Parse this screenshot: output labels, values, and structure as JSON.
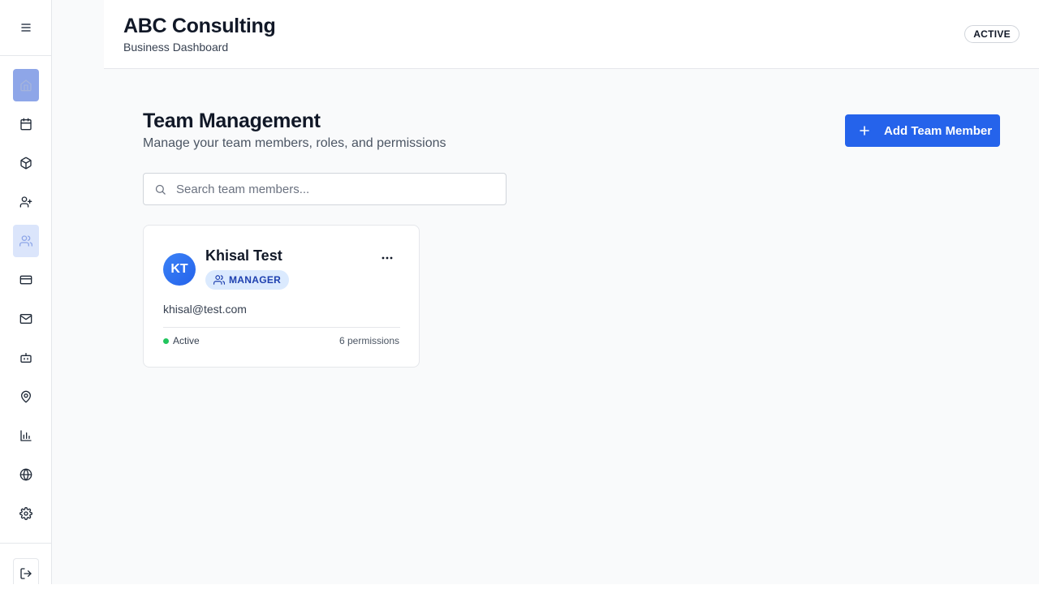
{
  "header": {
    "company_name": "ABC Consulting",
    "subtitle": "Business Dashboard",
    "status": "ACTIVE"
  },
  "sidebar": {
    "items": [
      {
        "icon": "home-icon",
        "active": true
      },
      {
        "icon": "calendar-icon"
      },
      {
        "icon": "package-icon"
      },
      {
        "icon": "user-plus-icon"
      },
      {
        "icon": "users-icon",
        "active": true
      },
      {
        "icon": "credit-card-icon"
      },
      {
        "icon": "mail-icon"
      },
      {
        "icon": "bot-icon"
      },
      {
        "icon": "map-pin-icon"
      },
      {
        "icon": "bar-chart-icon"
      },
      {
        "icon": "globe-icon"
      },
      {
        "icon": "settings-icon"
      }
    ],
    "logout_icon": "logout-icon"
  },
  "main": {
    "title": "Team Management",
    "subtitle": "Manage your team members, roles, and permissions",
    "add_button_label": "Add Team Member",
    "search": {
      "placeholder": "Search team members...",
      "value": ""
    },
    "members": [
      {
        "initials": "KT",
        "name": "Khisal Test",
        "role": "MANAGER",
        "email": "khisal@test.com",
        "status": "Active",
        "permissions": "6 permissions"
      }
    ]
  },
  "colors": {
    "primary": "#2563eb",
    "active_status": "#22c55e",
    "role_badge_bg": "#dbeafe",
    "role_badge_text": "#1e40af"
  }
}
